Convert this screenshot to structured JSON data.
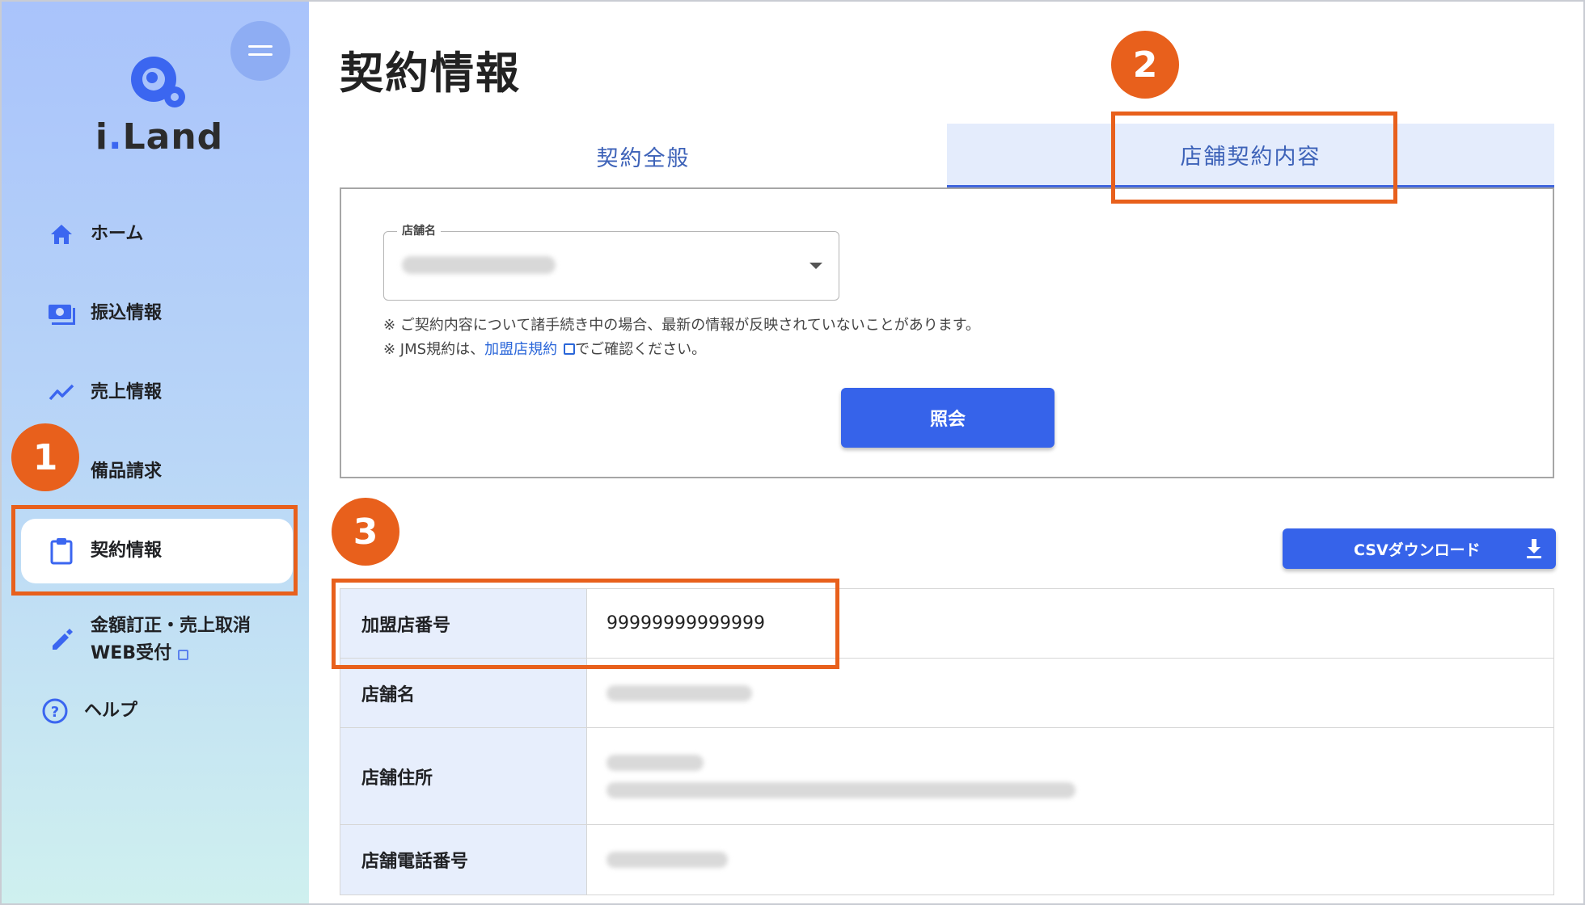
{
  "brand": {
    "name_prefix": "i",
    "name_dot": ".",
    "name_suffix": "Land",
    "accent": "#3b66f0"
  },
  "sidebar": {
    "items": [
      {
        "label": "ホーム",
        "icon": "home-icon"
      },
      {
        "label": "振込情報",
        "icon": "money-icon"
      },
      {
        "label": "売上情報",
        "icon": "chart-line-icon"
      },
      {
        "label": "備品請求",
        "icon": "supply-icon"
      },
      {
        "label": "契約情報",
        "icon": "clipboard-icon",
        "active": true
      },
      {
        "label": "金額訂正・売上取消",
        "label2": "WEB受付",
        "icon": "pencil-icon"
      },
      {
        "label": "ヘルプ",
        "icon": "help-icon"
      }
    ]
  },
  "page": {
    "title": "契約情報"
  },
  "tabs": [
    {
      "label": "契約全般"
    },
    {
      "label": "店舗契約内容",
      "active": true
    }
  ],
  "search": {
    "field_label": "店舗名",
    "note1": "※ ご契約内容について諸手続き中の場合、最新の情報が反映されていないことがあります。",
    "note2_prefix": "※ JMS規約は、",
    "note2_link": "加盟店規約",
    "note2_suffix": "でご確認ください。",
    "query_button": "照会"
  },
  "csv_button": "CSVダウンロード",
  "table": {
    "rows": [
      {
        "label": "加盟店番号",
        "value": "99999999999999"
      },
      {
        "label": "店舗名"
      },
      {
        "label": "店舗住所"
      },
      {
        "label": "店舗電話番号"
      }
    ]
  },
  "annotations": {
    "badge1": "1",
    "badge2": "2",
    "badge3": "3",
    "color": "#e8601c"
  }
}
